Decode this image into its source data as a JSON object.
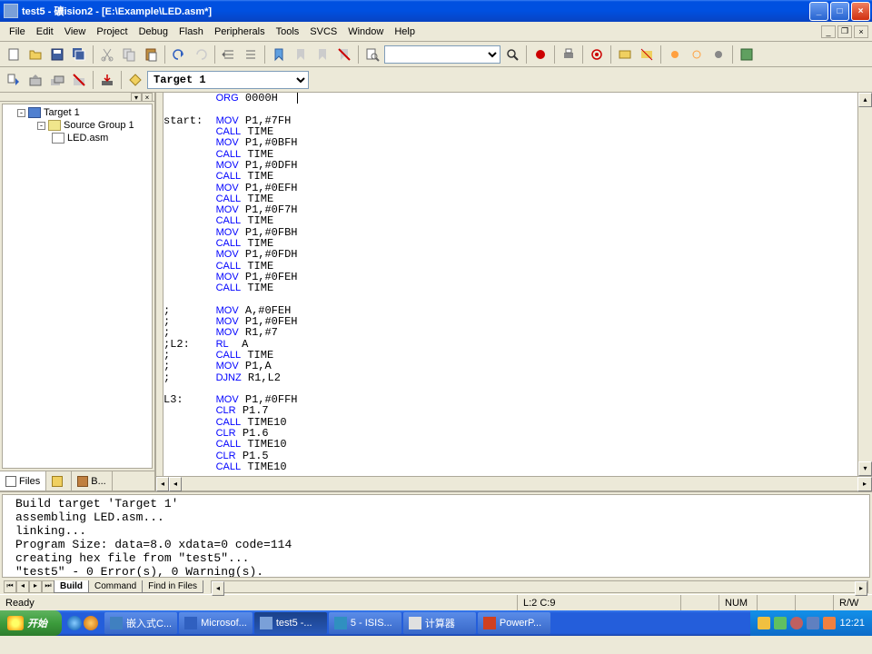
{
  "title": "test5 - 礦ision2 - [E:\\Example\\LED.asm*]",
  "menu": [
    "File",
    "Edit",
    "View",
    "Project",
    "Debug",
    "Flash",
    "Peripherals",
    "Tools",
    "SVCS",
    "Window",
    "Help"
  ],
  "target_combo": "Target 1",
  "project_tree": {
    "target": "Target 1",
    "group": "Source Group 1",
    "file": "LED.asm"
  },
  "project_tabs": {
    "files": "Files",
    "regs": "",
    "books": "B..."
  },
  "code_lines": [
    {
      "label": "",
      "kw": "ORG",
      "args": "0000H"
    },
    {
      "label": "",
      "kw": "",
      "args": ""
    },
    {
      "label": "start:",
      "kw": "MOV",
      "args": "P1,#7FH"
    },
    {
      "label": "",
      "kw": "CALL",
      "args": "TIME"
    },
    {
      "label": "",
      "kw": "MOV",
      "args": "P1,#0BFH"
    },
    {
      "label": "",
      "kw": "CALL",
      "args": "TIME"
    },
    {
      "label": "",
      "kw": "MOV",
      "args": "P1,#0DFH"
    },
    {
      "label": "",
      "kw": "CALL",
      "args": "TIME"
    },
    {
      "label": "",
      "kw": "MOV",
      "args": "P1,#0EFH"
    },
    {
      "label": "",
      "kw": "CALL",
      "args": "TIME"
    },
    {
      "label": "",
      "kw": "MOV",
      "args": "P1,#0F7H"
    },
    {
      "label": "",
      "kw": "CALL",
      "args": "TIME"
    },
    {
      "label": "",
      "kw": "MOV",
      "args": "P1,#0FBH"
    },
    {
      "label": "",
      "kw": "CALL",
      "args": "TIME"
    },
    {
      "label": "",
      "kw": "MOV",
      "args": "P1,#0FDH"
    },
    {
      "label": "",
      "kw": "CALL",
      "args": "TIME"
    },
    {
      "label": "",
      "kw": "MOV",
      "args": "P1,#0FEH"
    },
    {
      "label": "",
      "kw": "CALL",
      "args": "TIME"
    },
    {
      "label": "",
      "kw": "",
      "args": ""
    },
    {
      "label": ";",
      "kw": "MOV",
      "args": "A,#0FEH"
    },
    {
      "label": ";",
      "kw": "MOV",
      "args": "P1,#0FEH"
    },
    {
      "label": ";",
      "kw": "MOV",
      "args": "R1,#7"
    },
    {
      "label": ";L2:",
      "kw": "RL",
      "args": " A"
    },
    {
      "label": ";",
      "kw": "CALL",
      "args": "TIME"
    },
    {
      "label": ";",
      "kw": "MOV",
      "args": "P1,A"
    },
    {
      "label": ";",
      "kw": "DJNZ",
      "args": "R1,L2"
    },
    {
      "label": "",
      "kw": "",
      "args": ""
    },
    {
      "label": "L3:",
      "kw": "MOV",
      "args": "P1,#0FFH"
    },
    {
      "label": "",
      "kw": "CLR",
      "args": "P1.7"
    },
    {
      "label": "",
      "kw": "CALL",
      "args": "TIME10"
    },
    {
      "label": "",
      "kw": "CLR",
      "args": "P1.6"
    },
    {
      "label": "",
      "kw": "CALL",
      "args": "TIME10"
    },
    {
      "label": "",
      "kw": "CLR",
      "args": "P1.5"
    },
    {
      "label": "",
      "kw": "CALL",
      "args": "TIME10"
    }
  ],
  "output_lines": [
    "Build target 'Target 1'",
    "assembling LED.asm...",
    "linking...",
    "Program Size: data=8.0 xdata=0 code=114",
    "creating hex file from \"test5\"...",
    "\"test5\" - 0 Error(s), 0 Warning(s)."
  ],
  "output_tabs": {
    "build": "Build",
    "command": "Command",
    "find": "Find in Files"
  },
  "status": {
    "ready": "Ready",
    "pos": "L:2 C:9",
    "num": "NUM",
    "rw": "R/W"
  },
  "taskbar": {
    "start": "开始",
    "tasks": [
      "嵌入式C...",
      "Microsof...",
      "test5  -...",
      "5 - ISIS...",
      "计算器",
      "PowerP..."
    ],
    "clock": "12:21"
  }
}
